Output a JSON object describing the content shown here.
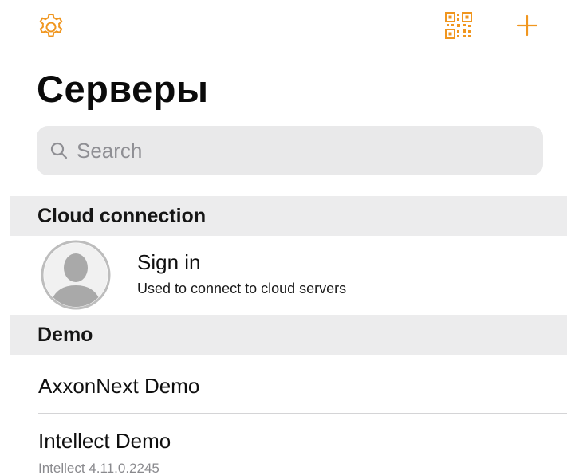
{
  "colors": {
    "accent": "#f0961f",
    "section_bg": "#ececed",
    "search_bg": "#e9e9ea",
    "secondary_text": "#8a8a8e"
  },
  "toolbar": {
    "left_icon": "gear-icon",
    "right_icons": [
      "qr-code-icon",
      "plus-icon"
    ]
  },
  "page": {
    "title": "Серверы"
  },
  "search": {
    "placeholder": "Search",
    "value": ""
  },
  "sections": {
    "cloud": {
      "header": "Cloud connection",
      "sign_in": {
        "icon": "user-avatar-icon",
        "title": "Sign in",
        "subtitle": "Used to connect to cloud servers"
      }
    },
    "demo": {
      "header": "Demo",
      "servers": [
        {
          "name": "AxxonNext Demo",
          "subtitle": ""
        },
        {
          "name": "Intellect Demo",
          "subtitle": "Intellect 4.11.0.2245"
        }
      ]
    }
  }
}
